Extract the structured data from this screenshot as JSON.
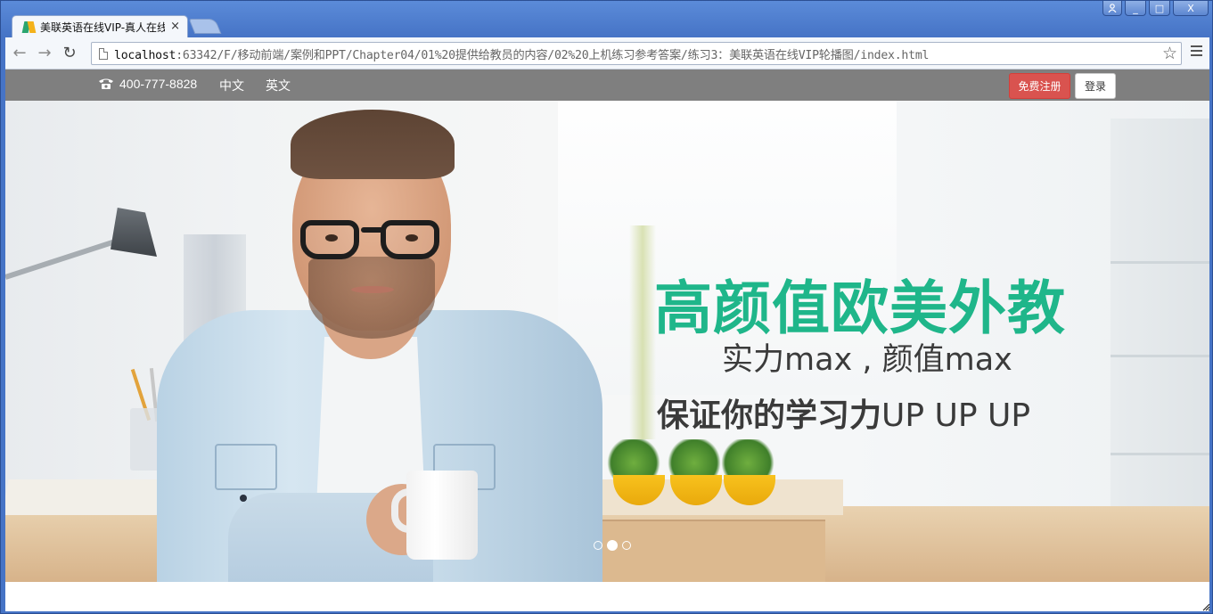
{
  "browser": {
    "tab_title": "美联英语在线VIP-真人在线",
    "tab_close": "×",
    "window_buttons": [
      "_",
      "□",
      "X"
    ],
    "url_host": "localhost",
    "url_path": ":63342/F/移动前端/案例和PPT/Chapter04/01%20提供给教员的内容/02%20上机练习参考答案/练习3：美联英语在线VIP轮播图/index.html",
    "back_icon": "←",
    "forward_icon": "→",
    "reload_icon": "↻",
    "star_icon": "☆"
  },
  "topbar": {
    "phone": "400-777-8828",
    "lang_cn": "中文",
    "lang_en": "英文",
    "register_label": "免费注册",
    "login_label": "登录"
  },
  "banner": {
    "headline": "高颜值欧美外教",
    "subline": "实力max , 颜值max",
    "tagline_bold": "保证你的学习力",
    "tagline_up": "UP UP UP",
    "slides_count": 3,
    "active_slide": 2
  },
  "colors": {
    "topbar_bg": "#7f7f7f",
    "register_bg": "#d9534f",
    "headline": "#1fb68a"
  }
}
